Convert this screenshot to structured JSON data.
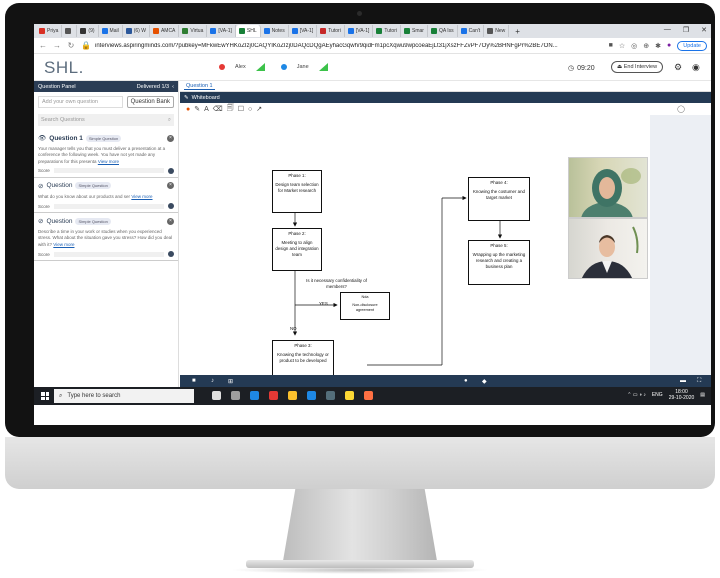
{
  "browser": {
    "tabs": [
      {
        "label": "Priya",
        "color": "#d93025"
      },
      {
        "label": "",
        "color": "#555"
      },
      {
        "label": "(9)",
        "color": "#333"
      },
      {
        "label": "Mail",
        "color": "#1a73e8"
      },
      {
        "label": "(6) W",
        "color": "#2b579a"
      },
      {
        "label": "AMCA",
        "color": "#e65100"
      },
      {
        "label": "Virtua",
        "color": "#2e7d32"
      },
      {
        "label": "[VA-1]",
        "color": "#1a73e8"
      },
      {
        "label": "SHL",
        "color": "#188038"
      },
      {
        "label": "Notes",
        "color": "#1a73e8"
      },
      {
        "label": "[VA-1]",
        "color": "#1a73e8"
      },
      {
        "label": "Tutori",
        "color": "#c62828"
      },
      {
        "label": "[VA-1]",
        "color": "#1a73e8"
      },
      {
        "label": "Tutori",
        "color": "#188038"
      },
      {
        "label": "Smar",
        "color": "#188038"
      },
      {
        "label": "QA Iss",
        "color": "#188038"
      },
      {
        "label": "Can't",
        "color": "#1a73e8"
      },
      {
        "label": "New",
        "color": "#555"
      }
    ],
    "new_tab": "+",
    "window_controls": [
      "—",
      "❐",
      "✕"
    ],
    "url": "interviews.aspiringminds.com/?pubkey=MFkwEwYHKoZIzj0CAQYIKoZIzj0DAQcDQgAEyhacGqwh/9qidFm1pcXqwu9wpcoeaEjLt31jXszFFZvPF7Oy%2BHNFgPr%2BE7ON...",
    "update_label": "Update"
  },
  "app": {
    "logo": "SHL.",
    "participants": [
      {
        "name": "Alex",
        "color": "#e53935"
      },
      {
        "name": "Jane",
        "color": "#1e88e5"
      }
    ],
    "timer": "09:20",
    "end_interview": "End Interview"
  },
  "question_panel": {
    "title": "Question Panel",
    "delivered": "Delivered 1/3",
    "add_placeholder": "Add your own question",
    "bank_button": "Question Bank",
    "search_placeholder": "Search Questions",
    "questions": [
      {
        "title": "Question 1",
        "badge": "Simple Question",
        "text": "Your manager tells you that you must deliver a presentation at a conference the following week. You have not yet made any preparations for this presenta",
        "more": "View more",
        "score_label": "Score"
      },
      {
        "title": "Question",
        "badge": "Simple Question",
        "text": "What do you know about our products and ser",
        "more": "View more",
        "score_label": "Score"
      },
      {
        "title": "Question",
        "badge": "Simple Question",
        "text": "Describe a time in your work or studies when you experienced stress. What about the situation gave you stress? How did you deal with it?",
        "more": "View more",
        "score_label": "Score"
      }
    ]
  },
  "whiteboard": {
    "tab": "Question 1",
    "title": "Whiteboard",
    "tools": [
      "●",
      "✎",
      "A",
      "⌫",
      "🗐",
      "☐",
      "○",
      "↗"
    ],
    "flow": {
      "phase1": {
        "title": "Phase 1:",
        "body": "Design team selection for Market research"
      },
      "phase2": {
        "title": "Phase 2:",
        "body": "Meeting to align design and integration team"
      },
      "question": "Is it necessary confidentiality of members?",
      "yes": "YES",
      "no": "NO",
      "nda": {
        "title": "Nda",
        "body": "Non-disclosure agreement"
      },
      "phase3": {
        "title": "Phase 3:",
        "body": "Knowing the technology or product to be developed"
      },
      "phase4": {
        "title": "Phase 4:",
        "body": "Knowing the costumer and target market"
      },
      "phase5": {
        "title": "Phase 5:",
        "body": "Wrapping up the marketing research and creating a business plan"
      }
    }
  },
  "taskbar": {
    "search_placeholder": "Type here to search",
    "lang": "ENG",
    "time": "18:00",
    "date": "29-10-2020",
    "icon_colors": [
      "#e0e0e0",
      "#9e9e9e",
      "#1e88e5",
      "#e53935",
      "#fbc02d",
      "#1e88e5",
      "#546e7a",
      "#fdd835",
      "#ff7043"
    ]
  }
}
